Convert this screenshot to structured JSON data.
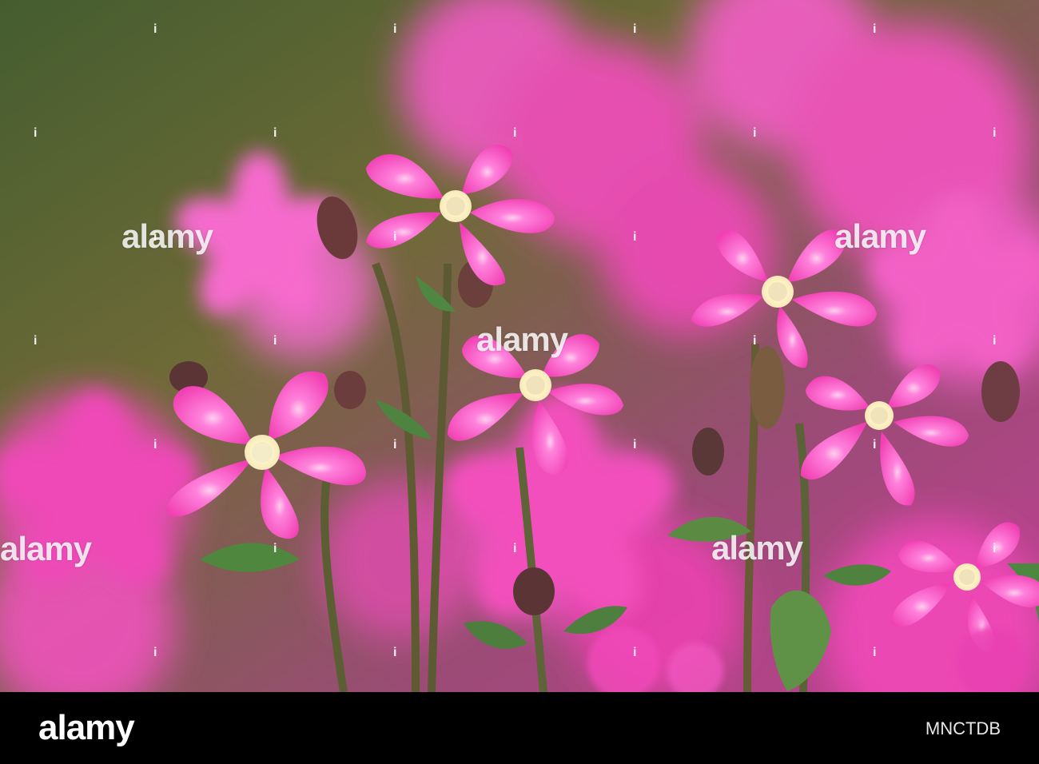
{
  "watermark": {
    "text": "alamy",
    "accent": "#ffffff"
  },
  "footer": {
    "brand": "alamy",
    "image_id": "MNCTDB"
  },
  "colors": {
    "flower_pink": "#ff4fbf",
    "flower_light": "#ff7fd8",
    "leaf_green": "#5a8a44",
    "background_green": "#5d6a3a",
    "footer": "#000000"
  }
}
